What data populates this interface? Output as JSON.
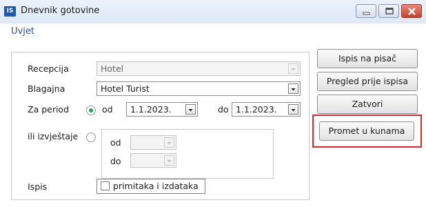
{
  "window": {
    "app_icon": "IS",
    "title": "Dnevnik gotovine"
  },
  "window_controls": {
    "minimize_icon": "minimize-icon",
    "maximize_icon": "maximize-icon",
    "close_icon": "close-icon"
  },
  "group": {
    "title": "Uvjet"
  },
  "form": {
    "recepcija": {
      "label": "Recepcija",
      "value": "Hotel",
      "disabled": true
    },
    "blagajna": {
      "label": "Blagajna",
      "value": "Hotel Turist"
    },
    "period": {
      "label": "Za period",
      "selected": true,
      "od_label": "od",
      "od_value": "1.1.2023.",
      "do_label": "do",
      "do_value": "1.1.2023."
    },
    "izvjestaje": {
      "label": "ili izvještaje",
      "selected": false,
      "od_label": "od",
      "do_label": "do",
      "od_value": "",
      "do_value": ""
    },
    "ispis": {
      "label": "Ispis",
      "checkbox_label": "primitaka i izdataka",
      "checked": false
    }
  },
  "buttons": {
    "print": "Ispis na pisač",
    "preview": "Pregled prije ispisa",
    "close": "Zatvori",
    "promet": "Promet u kunama"
  },
  "colors": {
    "accent": "#2c4fa3",
    "radio_selected": "#27a44a",
    "highlight": "#e0272c"
  }
}
